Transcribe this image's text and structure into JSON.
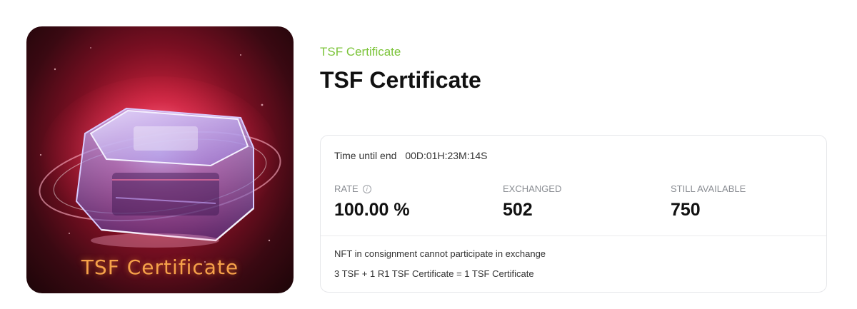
{
  "hero": {
    "image_text": "TSF Certificate"
  },
  "category": "TSF Certificate",
  "title": "TSF Certificate",
  "timer": {
    "label": "Time until end",
    "value": "00D:01H:23M:14S"
  },
  "stats": [
    {
      "label": "RATE",
      "value": "100.00 %",
      "icon": "info-icon"
    },
    {
      "label": "EXCHANGED",
      "value": "502"
    },
    {
      "label": "STILL AVAILABLE",
      "value": "750"
    }
  ],
  "notes": [
    "NFT in consignment cannot participate in exchange",
    "3 TSF + 1 R1 TSF Certificate = 1 TSF Certificate"
  ],
  "colors": {
    "category_accent": "#7cc43a",
    "hero_glow": "#f6a24a"
  }
}
